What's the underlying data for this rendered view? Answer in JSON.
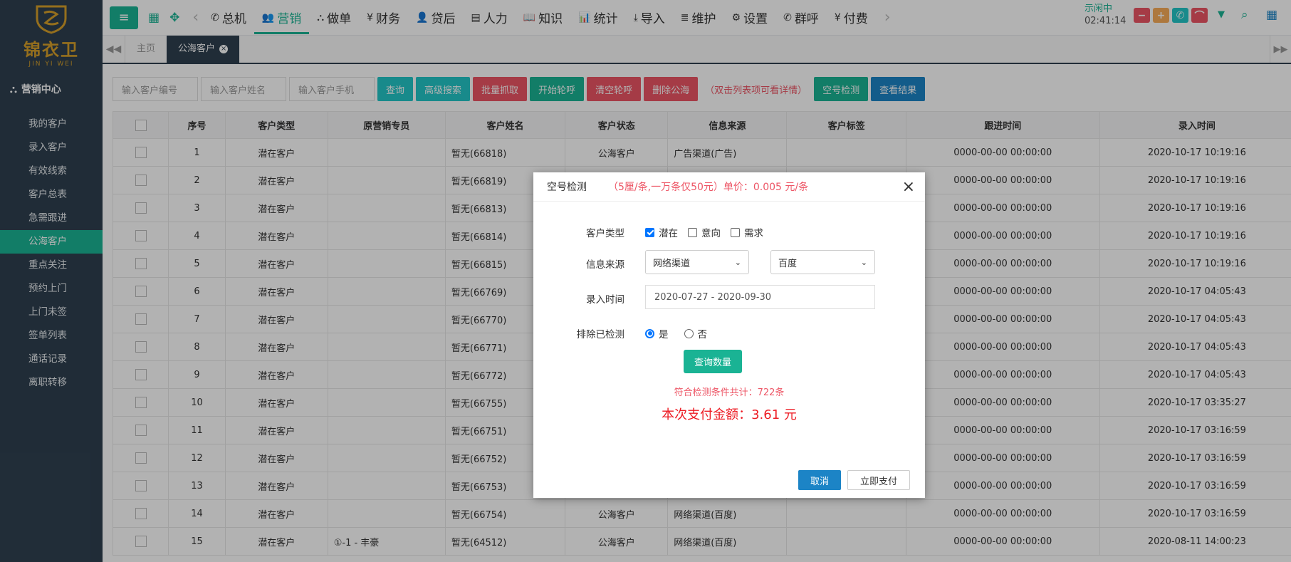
{
  "logo": {
    "cn": "锦衣卫",
    "en": "JIN YI WEI"
  },
  "sidebar": {
    "title": "营销中心",
    "items": [
      {
        "label": "我的客户"
      },
      {
        "label": "录入客户"
      },
      {
        "label": "有效线索"
      },
      {
        "label": "客户总表"
      },
      {
        "label": "急需跟进"
      },
      {
        "label": "公海客户",
        "active": true
      },
      {
        "label": "重点关注"
      },
      {
        "label": "预约上门"
      },
      {
        "label": "上门未签"
      },
      {
        "label": "签单列表"
      },
      {
        "label": "通话记录"
      },
      {
        "label": "离职转移"
      }
    ]
  },
  "nav": [
    {
      "icon": "phone-icon",
      "glyph": "✆",
      "label": "总机"
    },
    {
      "icon": "users-icon",
      "glyph": "👥",
      "label": "营销",
      "active": true
    },
    {
      "icon": "sitemap-icon",
      "glyph": "⛬",
      "label": "做单"
    },
    {
      "icon": "yen-icon",
      "glyph": "¥",
      "label": "财务"
    },
    {
      "icon": "user-plus-icon",
      "glyph": "👤",
      "label": "贷后"
    },
    {
      "icon": "id-card-icon",
      "glyph": "▤",
      "label": "人力"
    },
    {
      "icon": "book-icon",
      "glyph": "📖",
      "label": "知识"
    },
    {
      "icon": "bar-chart-icon",
      "glyph": "📊",
      "label": "统计"
    },
    {
      "icon": "download-icon",
      "glyph": "⤓",
      "label": "导入"
    },
    {
      "icon": "database-icon",
      "glyph": "≣",
      "label": "维护"
    },
    {
      "icon": "gear-icon",
      "glyph": "⚙",
      "label": "设置"
    },
    {
      "icon": "volume-icon",
      "glyph": "✆",
      "label": "群呼"
    },
    {
      "icon": "yen-icon",
      "glyph": "¥",
      "label": "付费"
    }
  ],
  "status": {
    "state": "示闲中",
    "time": "02:41:14"
  },
  "tabs": [
    {
      "label": "主页"
    },
    {
      "label": "公海客户",
      "active": true
    }
  ],
  "toolbar": {
    "placeholder_id": "输入客户编号",
    "placeholder_name": "输入客户姓名",
    "placeholder_phone": "输入客户手机",
    "query": "查询",
    "advanced": "高级搜索",
    "batch": "批量抓取",
    "start_call": "开始轮呼",
    "clear_call": "清空轮呼",
    "delete_pool": "删除公海",
    "hint": "（双击列表项可看详情）",
    "empty_check": "空号检测",
    "view_result": "查看结果"
  },
  "table": {
    "headers": [
      "",
      "序号",
      "客户类型",
      "原营销专员",
      "客户姓名",
      "客户状态",
      "信息来源",
      "客户标签",
      "跟进时间",
      "录入时间"
    ],
    "rows": [
      [
        "1",
        "潜在客户",
        "",
        "暂无(66818)",
        "公海客户",
        "广告渠道(广告)",
        "",
        "0000-00-00 00:00:00",
        "2020-10-17 10:19:16"
      ],
      [
        "2",
        "潜在客户",
        "",
        "暂无(66819)",
        "",
        "",
        "",
        "0000-00-00 00:00:00",
        "2020-10-17 10:19:16"
      ],
      [
        "3",
        "潜在客户",
        "",
        "暂无(66813)",
        "",
        "",
        "",
        "0000-00-00 00:00:00",
        "2020-10-17 10:19:16"
      ],
      [
        "4",
        "潜在客户",
        "",
        "暂无(66814)",
        "",
        "",
        "",
        "0000-00-00 00:00:00",
        "2020-10-17 10:19:16"
      ],
      [
        "5",
        "潜在客户",
        "",
        "暂无(66815)",
        "",
        "",
        "",
        "0000-00-00 00:00:00",
        "2020-10-17 10:19:16"
      ],
      [
        "6",
        "潜在客户",
        "",
        "暂无(66769)",
        "",
        "",
        "",
        "0000-00-00 00:00:00",
        "2020-10-17 04:05:43"
      ],
      [
        "7",
        "潜在客户",
        "",
        "暂无(66770)",
        "",
        "",
        "",
        "0000-00-00 00:00:00",
        "2020-10-17 04:05:43"
      ],
      [
        "8",
        "潜在客户",
        "",
        "暂无(66771)",
        "",
        "",
        "",
        "0000-00-00 00:00:00",
        "2020-10-17 04:05:43"
      ],
      [
        "9",
        "潜在客户",
        "",
        "暂无(66772)",
        "",
        "",
        "",
        "0000-00-00 00:00:00",
        "2020-10-17 04:05:43"
      ],
      [
        "10",
        "潜在客户",
        "",
        "暂无(66755)",
        "",
        "",
        "",
        "0000-00-00 00:00:00",
        "2020-10-17 03:35:27"
      ],
      [
        "11",
        "潜在客户",
        "",
        "暂无(66751)",
        "",
        "",
        "",
        "0000-00-00 00:00:00",
        "2020-10-17 03:16:59"
      ],
      [
        "12",
        "潜在客户",
        "",
        "暂无(66752)",
        "",
        "",
        "",
        "0000-00-00 00:00:00",
        "2020-10-17 03:16:59"
      ],
      [
        "13",
        "潜在客户",
        "",
        "暂无(66753)",
        "",
        "",
        "",
        "0000-00-00 00:00:00",
        "2020-10-17 03:16:59"
      ],
      [
        "14",
        "潜在客户",
        "",
        "暂无(66754)",
        "公海客户",
        "网络渠道(百度)",
        "",
        "0000-00-00 00:00:00",
        "2020-10-17 03:16:59"
      ],
      [
        "15",
        "潜在客户",
        "①-1 - 丰豪",
        "暂无(64512)",
        "公海客户",
        "网络渠道(百度)",
        "",
        "0000-00-00 00:00:00",
        "2020-08-11 14:00:23"
      ]
    ]
  },
  "modal": {
    "title": "空号检测",
    "price": "（5厘/条,一万条仅50元）单价：0.005 元/条",
    "customer_type_label": "客户类型",
    "type_options": [
      {
        "label": "潜在",
        "checked": true
      },
      {
        "label": "意向",
        "checked": false
      },
      {
        "label": "需求",
        "checked": false
      }
    ],
    "source_label": "信息来源",
    "source_value": "网络渠道",
    "source_sub_value": "百度",
    "date_label": "录入时间",
    "date_value": "2020-07-27 - 2020-09-30",
    "exclude_label": "排除已检测",
    "exclude_yes": "是",
    "exclude_no": "否",
    "query_button": "查询数量",
    "count_text": "符合检测条件共计：722条",
    "pay_text": "本次支付金额：3.61 元",
    "cancel": "取消",
    "pay_now": "立即支付"
  },
  "colors": {
    "primary": "#1ab394",
    "sidebar": "#2f4050",
    "danger": "#ed5565",
    "info": "#23c6c8",
    "blue": "#1c84c6"
  }
}
